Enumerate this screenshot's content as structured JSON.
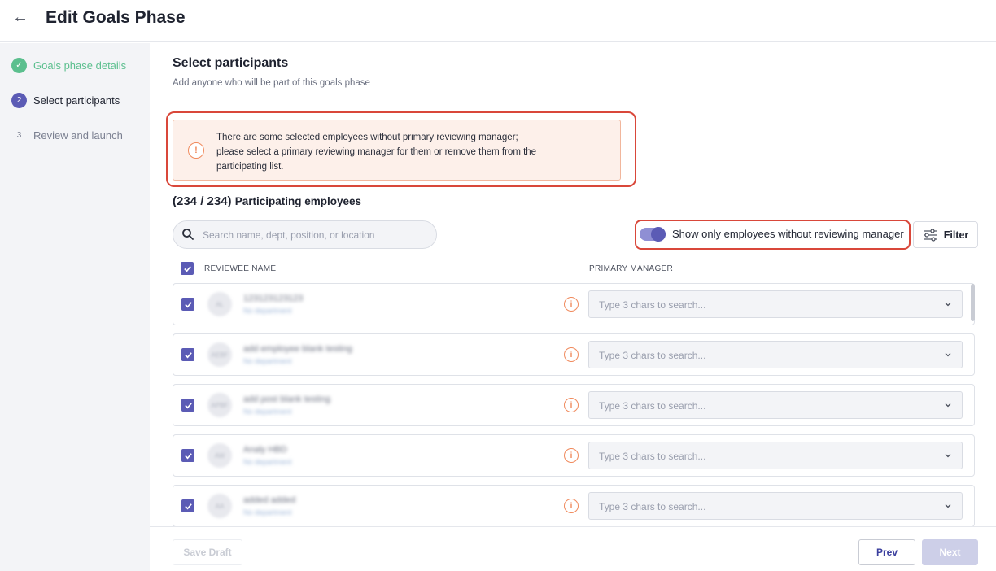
{
  "header": {
    "title": "Edit Goals Phase"
  },
  "steps": [
    {
      "num": "✓",
      "label": "Goals phase details",
      "state": "done"
    },
    {
      "num": "2",
      "label": "Select participants",
      "state": "active"
    },
    {
      "num": "3",
      "label": "Review and launch",
      "state": "todo"
    }
  ],
  "section": {
    "title": "Select participants",
    "subtitle": "Add anyone who will be part of this goals phase"
  },
  "alert": {
    "icon": "alert-circle-icon",
    "line1": "There are some selected employees without primary reviewing manager;",
    "line2": "please select a primary reviewing manager for them or remove them from the",
    "line3": "participating list."
  },
  "participants": {
    "count": "(234 / 234)",
    "label": "Participating employees"
  },
  "search": {
    "placeholder": "Search name, dept, position, or location",
    "value": ""
  },
  "toggle": {
    "label": "Show only employees without reviewing manager",
    "on": true
  },
  "filter": {
    "label": "Filter"
  },
  "table": {
    "col_name": "REVIEWEE NAME",
    "col_manager": "PRIMARY MANAGER",
    "rows": [
      {
        "initials": "AL",
        "name": "123123123123",
        "dept": "No department",
        "manager_placeholder": "Type 3 chars to search...",
        "checked": true
      },
      {
        "initials": "AEBF",
        "name": "add employee blank testing",
        "dept": "No department",
        "manager_placeholder": "Type 3 chars to search...",
        "checked": true
      },
      {
        "initials": "APBF",
        "name": "add post blank testing",
        "dept": "No department",
        "manager_placeholder": "Type 3 chars to search...",
        "checked": true
      },
      {
        "initials": "AW",
        "name": "Analy HBD",
        "dept": "No department",
        "manager_placeholder": "Type 3 chars to search...",
        "checked": true
      },
      {
        "initials": "AA",
        "name": "added added",
        "dept": "No department",
        "manager_placeholder": "Type 3 chars to search...",
        "checked": true
      }
    ]
  },
  "footer": {
    "save_draft": "Save Draft",
    "prev": "Prev",
    "next": "Next"
  },
  "colors": {
    "accent": "#5b5bb5",
    "success": "#5bbf8e",
    "warning": "#f08a5d",
    "highlight": "#d9473a"
  }
}
